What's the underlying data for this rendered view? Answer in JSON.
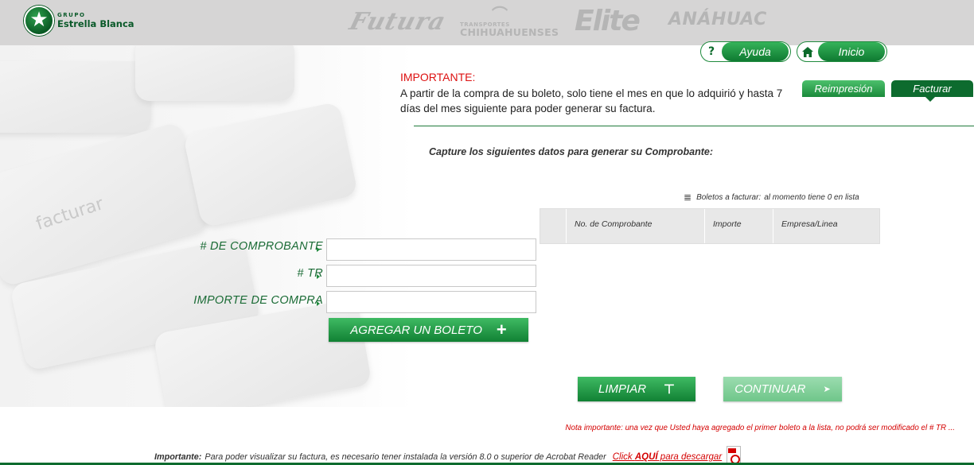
{
  "header": {
    "logo": {
      "sup": "GRUPO",
      "main": "Estrella Blanca"
    },
    "brands": [
      "Futura",
      "TRANSPORTES",
      "CHIHUAHUENSES",
      "Elite",
      "ANÁHUAC"
    ]
  },
  "nav": {
    "help_icon": "?",
    "help_label": "Ayuda",
    "home_label": "Inicio",
    "tab_reimpresion": "Reimpresión",
    "tab_facturar": "Facturar"
  },
  "notice": {
    "title": "IMPORTANTE:",
    "text": "A partir de la compra de su boleto, solo tiene el mes en que lo adquirió y hasta 7 días del mes siguiente para poder generar su factura."
  },
  "capture_text": "Capture los siguientes datos para generar su Comprobante:",
  "keyboard_label": "facturar",
  "form": {
    "comprobante_label": "# DE COMPROBANTE",
    "tr_label": "# TR",
    "importe_label": "IMPORTE DE COMPRA",
    "comprobante_value": "",
    "tr_value": "",
    "importe_value": "",
    "agregar_label": "AGREGAR UN BOLETO"
  },
  "list": {
    "caption": "Boletos a facturar:",
    "count_text": "al momento tiene 0 en lista",
    "columns": [
      "",
      "No. de Comprobante",
      "Importe",
      "Empresa/Linea"
    ]
  },
  "actions": {
    "limpiar": "LIMPIAR",
    "continuar": "CONTINUAR"
  },
  "nota": "Nota importante: una vez que Usted haya agregado el primer boleto a la lista, no podrá ser modificado el # TR ...",
  "footer": {
    "importante": "Importante:",
    "text": "Para poder visualizar su factura, es necesario tener instalada la versión 8.0 o superior de Acrobat Reader",
    "click": "Click ",
    "aqui": "AQUÍ",
    "download": " para descargar"
  },
  "colors": {
    "green": "#1b8a3b",
    "dark_green": "#0d6b2e",
    "red": "#d40000",
    "header_gray": "#d6d5d5"
  }
}
